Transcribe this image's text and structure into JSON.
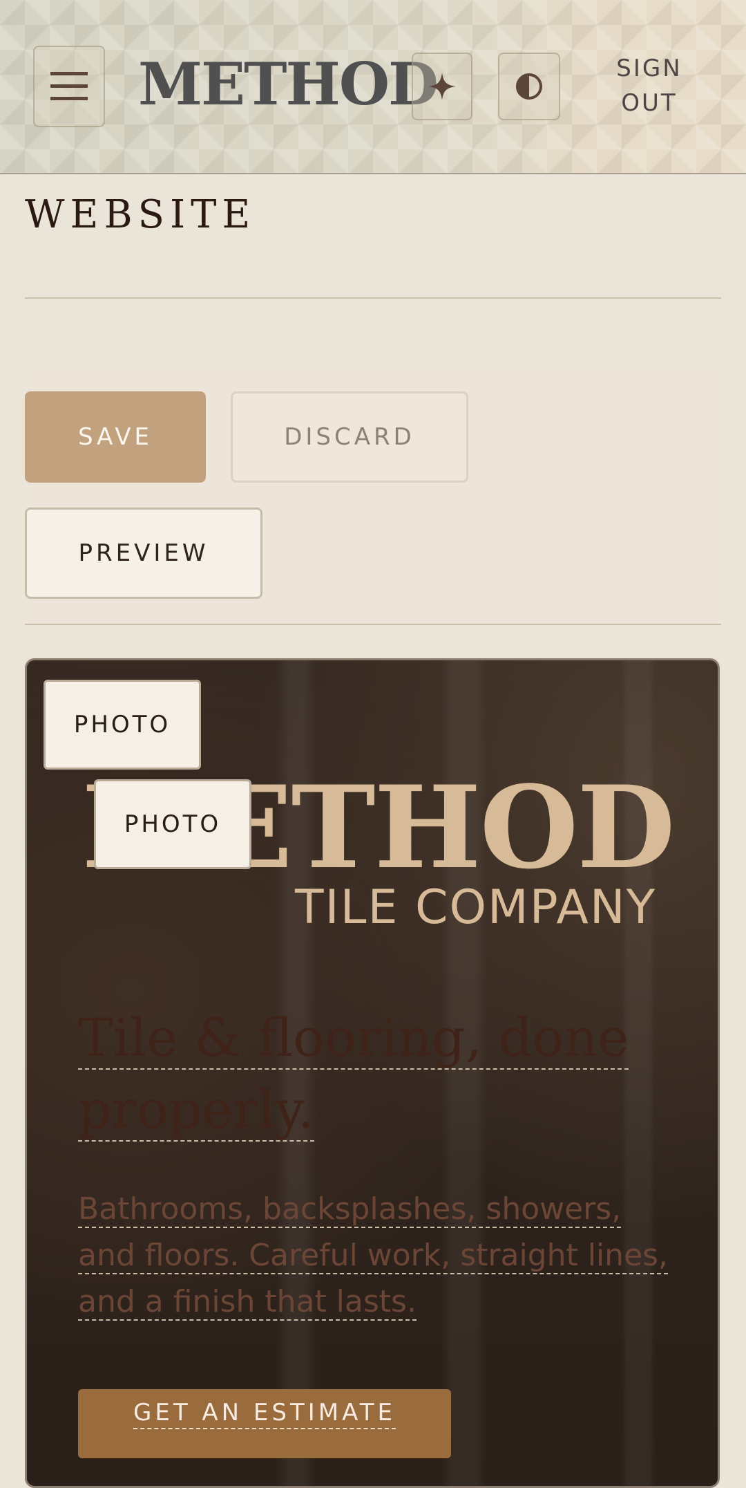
{
  "header": {
    "logo_text": "METHOD",
    "menu_icon": "hamburger-icon",
    "sparkle_icon": "sparkle-icon",
    "contrast_icon": "contrast-icon",
    "signout_line1": "SIGN",
    "signout_line2": "OUT"
  },
  "page": {
    "title": "WEBSITE"
  },
  "actions": {
    "save_label": "SAVE",
    "discard_label": "DISCARD",
    "preview_label": "PREVIEW"
  },
  "hero": {
    "photo_button_1": "PHOTO",
    "photo_button_2": "PHOTO",
    "logo_text": "METHOD",
    "logo_subtitle": "TILE COMPANY",
    "headline": "Tile & flooring, done properly.",
    "body": "Bathrooms, backsplashes, showers, and floors. Careful work, straight lines, and a finish that lasts.",
    "cta_label": "GET AN ESTIMATE"
  },
  "colors": {
    "accent": "#c2a17e",
    "hero_logo": "#d7bb98",
    "cta": "#9a6b3d"
  }
}
